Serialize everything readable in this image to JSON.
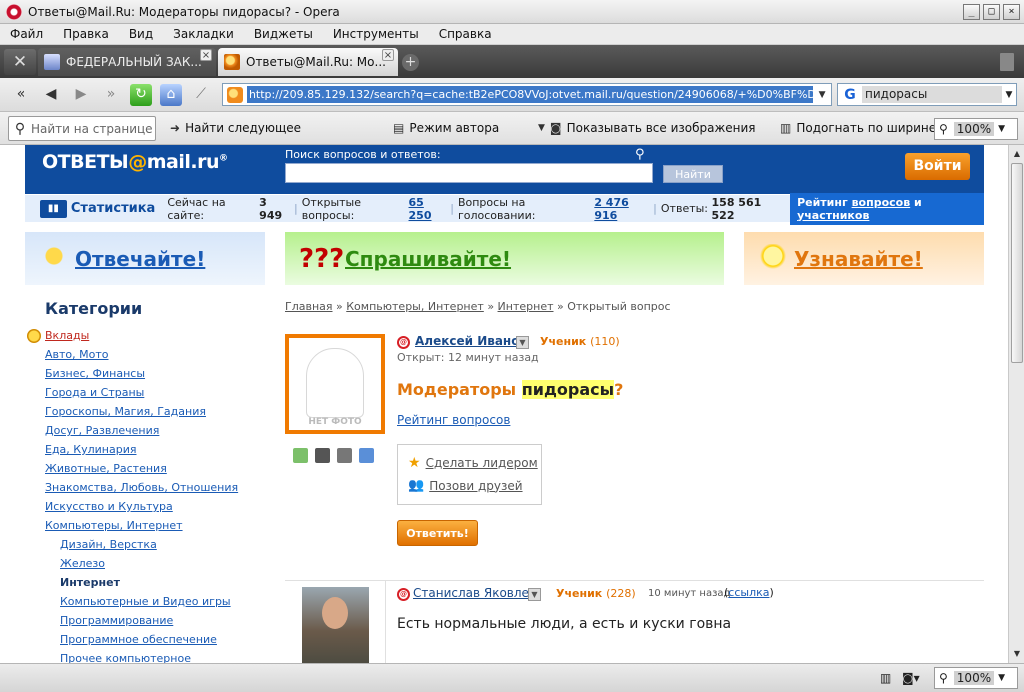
{
  "window": {
    "title": "Ответы@Mail.Ru: Модераторы пидорасы? - Opera",
    "btn_min": "_",
    "btn_max": "□",
    "btn_close": "×"
  },
  "menu": [
    "Файл",
    "Правка",
    "Вид",
    "Закладки",
    "Виджеты",
    "Инструменты",
    "Справка"
  ],
  "tabs": [
    {
      "label": "ФЕДЕРАЛЬНЫЙ ЗАК..."
    },
    {
      "label": "Ответы@Mail.Ru: Мо..."
    }
  ],
  "tab_close": "×",
  "tab_add": "+",
  "address": {
    "url": "http://209.85.129.132/search?q=cache:tB2ePCO8VVoJ:otvet.mail.ru/question/24906068/+%D0%BF%D0"
  },
  "search": {
    "value": "пидорасы",
    "engine": "G"
  },
  "findbar": {
    "placeholder": "Найти на странице",
    "find_next": "Найти следующее",
    "author_mode": "Режим автора",
    "show_images": "Показывать все изображения",
    "fit_width": "Подогнать по ширине",
    "zoom": "100%"
  },
  "status": {
    "zoom": "100%"
  },
  "header": {
    "logo_a": "ОТВЕТЫ",
    "logo_b": "@",
    "logo_c": "mail.ru",
    "logo_d": "®",
    "search_label": "Поиск вопросов и ответов:",
    "search_btn": "Найти",
    "login": "Войти"
  },
  "stats": {
    "title": "Статистика",
    "online_label": "Сейчас на сайте:",
    "online": "3 949",
    "open_label": "Открытые вопросы:",
    "open": "65 250",
    "vote_label": "Вопросы на голосовании:",
    "vote": "2 476 916",
    "answers_label": "Ответы:",
    "answers": "158 561 522",
    "rating_a": "Рейтинг",
    "rating_b": "вопросов",
    "rating_c": "и",
    "rating_d": "участников"
  },
  "promo": {
    "answer": "Отвечайте!",
    "ask": "Спрашивайте!",
    "learn": "Узнавайте!",
    "ask_marks": "???"
  },
  "sidebar": {
    "title": "Категории",
    "items": [
      {
        "label": "Вклады",
        "kind": "hot"
      },
      {
        "label": "Авто, Мото",
        "kind": ""
      },
      {
        "label": "Бизнес, Финансы",
        "kind": ""
      },
      {
        "label": "Города и Страны",
        "kind": ""
      },
      {
        "label": "Гороскопы, Магия, Гадания",
        "kind": ""
      },
      {
        "label": "Досуг, Развлечения",
        "kind": ""
      },
      {
        "label": "Еда, Кулинария",
        "kind": ""
      },
      {
        "label": "Животные, Растения",
        "kind": ""
      },
      {
        "label": "Знакомства, Любовь, Отношения",
        "kind": ""
      },
      {
        "label": "Искусство и Культура",
        "kind": ""
      },
      {
        "label": "Компьютеры, Интернет",
        "kind": ""
      },
      {
        "label": "Дизайн, Верстка",
        "kind": "sub"
      },
      {
        "label": "Железо",
        "kind": "sub"
      },
      {
        "label": "Интернет",
        "kind": "sub active"
      },
      {
        "label": "Компьютерные и Видео игры",
        "kind": "sub"
      },
      {
        "label": "Программирование",
        "kind": "sub"
      },
      {
        "label": "Программное обеспечение",
        "kind": "sub"
      },
      {
        "label": "Прочее компьютерное",
        "kind": "sub"
      }
    ]
  },
  "breadcrumb": {
    "home": "Главная",
    "sep": "»",
    "cat": "Компьютеры, Интернет",
    "sub": "Интернет",
    "current": "Открытый вопрос"
  },
  "question": {
    "no_photo": "НЕТ ФОТО",
    "user": "Алексей Иванов",
    "rank": "Ученик",
    "points": "(110)",
    "opened": "Открыт: 12 минут назад",
    "title_a": "Модераторы",
    "title_hl": "пидорасы",
    "title_b": "?",
    "rating_link": "Рейтинг вопросов",
    "make_leader": "Сделать лидером",
    "invite": "Позови друзей",
    "answer_btn": "Ответить!"
  },
  "answer": {
    "user": "Станислав Яковлев",
    "rank": "Ученик",
    "points": "(228)",
    "time": "10 минут назад",
    "link_open": "(",
    "link": "ссылка",
    "link_close": ")",
    "text": "Есть нормальные люди, а есть и куски говна"
  }
}
